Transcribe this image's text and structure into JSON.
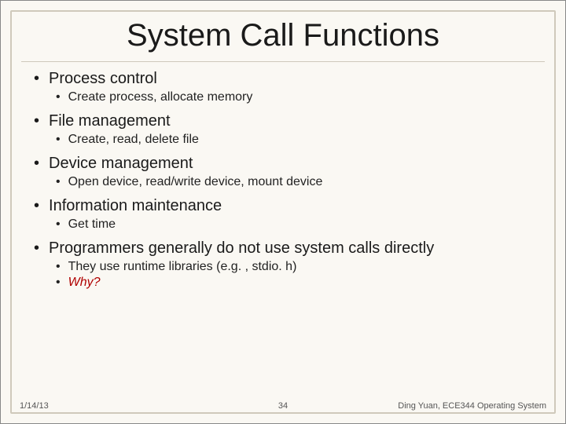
{
  "title": "System Call Functions",
  "bullets": [
    {
      "text": "Process control",
      "sub": [
        {
          "text": "Create process, allocate memory"
        }
      ]
    },
    {
      "text": "File management",
      "sub": [
        {
          "text": "Create, read, delete file"
        }
      ]
    },
    {
      "text": "Device management",
      "sub": [
        {
          "text": "Open device, read/write device, mount device"
        }
      ]
    },
    {
      "text": "Information maintenance",
      "sub": [
        {
          "text": "Get time"
        }
      ]
    },
    {
      "text": "Programmers generally do not use system calls directly",
      "sub": [
        {
          "text": "They use runtime libraries (e.g. , stdio. h)"
        },
        {
          "text": "Why?",
          "emphasis": true
        }
      ]
    }
  ],
  "footer": {
    "date": "1/14/13",
    "page": "34",
    "author": "Ding Yuan, ECE344 Operating System"
  }
}
